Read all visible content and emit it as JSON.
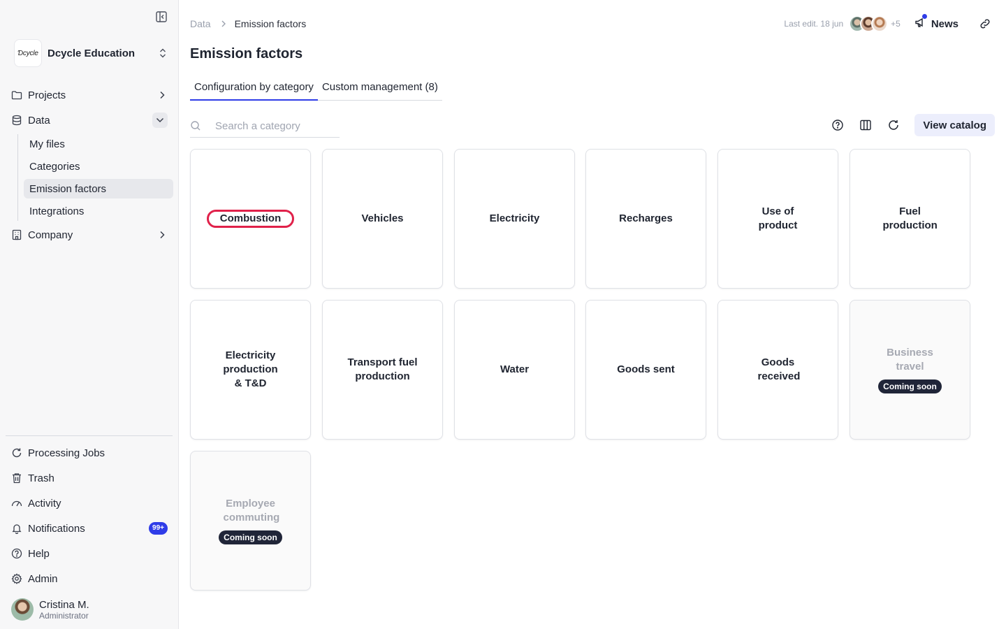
{
  "sidebar": {
    "org_name": "Dcycle Education",
    "org_logo_text": "Ɗcycle",
    "nav": [
      {
        "label": "Projects"
      },
      {
        "label": "Data"
      },
      {
        "label": "Company"
      }
    ],
    "data_subitems": [
      "My files",
      "Categories",
      "Emission factors",
      "Integrations"
    ],
    "bottom": {
      "processing": "Processing Jobs",
      "trash": "Trash",
      "activity": "Activity",
      "notifications": "Notifications",
      "notifications_badge": "99+",
      "help": "Help",
      "admin": "Admin"
    },
    "user": {
      "name": "Cristina M.",
      "role": "Administrator"
    }
  },
  "breadcrumb": {
    "root": "Data",
    "current": "Emission factors"
  },
  "header": {
    "last_edit": "Last edit. 18 jun",
    "more_editors": "+5",
    "news_label": "News"
  },
  "page": {
    "title": "Emission factors"
  },
  "tabs": [
    {
      "label": "Configuration by category",
      "active": true
    },
    {
      "label": "Custom management (8)",
      "active": false
    }
  ],
  "search": {
    "placeholder": "Search a category",
    "value": ""
  },
  "toolbar": {
    "view_catalog": "View catalog"
  },
  "categories": [
    {
      "label": "Combustion",
      "status": "available"
    },
    {
      "label": "Vehicles",
      "status": "available"
    },
    {
      "label": "Electricity",
      "status": "available"
    },
    {
      "label": "Recharges",
      "status": "available"
    },
    {
      "label": "Use of product",
      "status": "available"
    },
    {
      "label": "Fuel production",
      "status": "available"
    },
    {
      "label": "Electricity production & T&D",
      "status": "available"
    },
    {
      "label": "Transport fuel production",
      "status": "available"
    },
    {
      "label": "Water",
      "status": "available"
    },
    {
      "label": "Goods sent",
      "status": "available"
    },
    {
      "label": "Goods received",
      "status": "available"
    },
    {
      "label": "Business travel",
      "status": "coming_soon"
    },
    {
      "label": "Employee commuting",
      "status": "coming_soon"
    }
  ],
  "coming_soon_label": "Coming soon",
  "colors": {
    "accent": "#2f3ce8",
    "highlight": "#e0214a",
    "badge_dark": "#202538"
  }
}
